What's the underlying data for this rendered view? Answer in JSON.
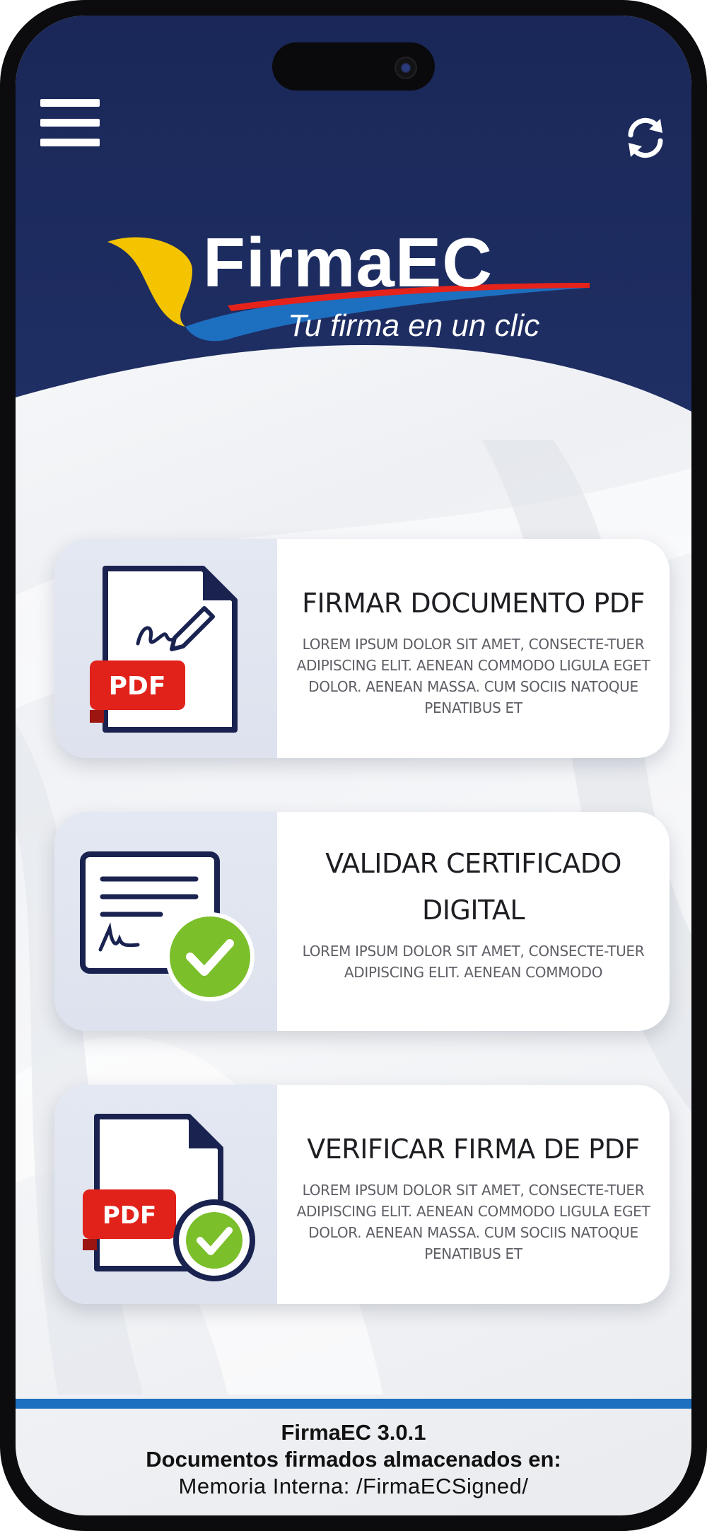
{
  "app": {
    "brand": "FirmaEC",
    "tagline": "Tu firma en un clic"
  },
  "header": {
    "menu_icon": "hamburger-menu-icon",
    "refresh_icon": "refresh-icon"
  },
  "cards": [
    {
      "title": "FIRMAR DOCUMENTO PDF",
      "description": "LOREM IPSUM DOLOR SIT AMET, CONSECTE-TUER ADIPISCING ELIT. AENEAN COMMODO LIGULA EGET DOLOR. AENEAN MASSA. CUM SOCIIS NATOQUE PENATIBUS ET",
      "icon": "sign-pdf-icon",
      "badge": "PDF"
    },
    {
      "title": "VALIDAR CERTIFICADO DIGITAL",
      "description": "LOREM IPSUM DOLOR SIT AMET, CONSECTE-TUER ADIPISCING ELIT. AENEAN COMMODO",
      "icon": "validate-certificate-icon"
    },
    {
      "title": "VERIFICAR FIRMA DE PDF",
      "description": "LOREM IPSUM DOLOR SIT AMET, CONSECTE-TUER ADIPISCING ELIT. AENEAN COMMODO LIGULA EGET DOLOR. AENEAN MASSA. CUM SOCIIS NATOQUE PENATIBUS ET",
      "icon": "verify-pdf-signature-icon",
      "badge": "PDF"
    }
  ],
  "footer": {
    "version": "FirmaEC 3.0.1",
    "storage_label": "Documentos firmados almacenados en:",
    "storage_path": "Memoria Interna: /FirmaECSigned/"
  },
  "colors": {
    "header_bg": "#1a2a5a",
    "accent_blue": "#1d6fc0",
    "accent_yellow": "#f5c400",
    "accent_red": "#e5231b",
    "check_green": "#7bbf2a",
    "icon_navy": "#1a2350"
  }
}
